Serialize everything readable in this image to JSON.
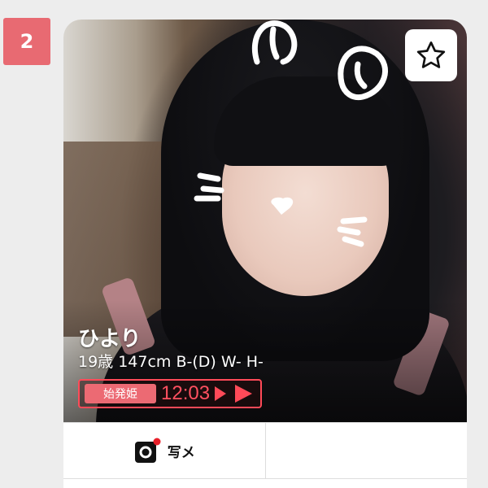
{
  "rank": "2",
  "profile": {
    "name": "ひより",
    "stats": "19歳 147cm B-(D) W- H-"
  },
  "shift": {
    "tag": "始発姫",
    "time": "12:03"
  },
  "actions": {
    "photo_mail_label": "写メ"
  },
  "colors": {
    "accent": "#e86a72",
    "shift_red": "#ff4a58"
  },
  "icons": {
    "favorite": "star-icon",
    "camera": "camera-icon",
    "play": "play-arrow-icon"
  }
}
